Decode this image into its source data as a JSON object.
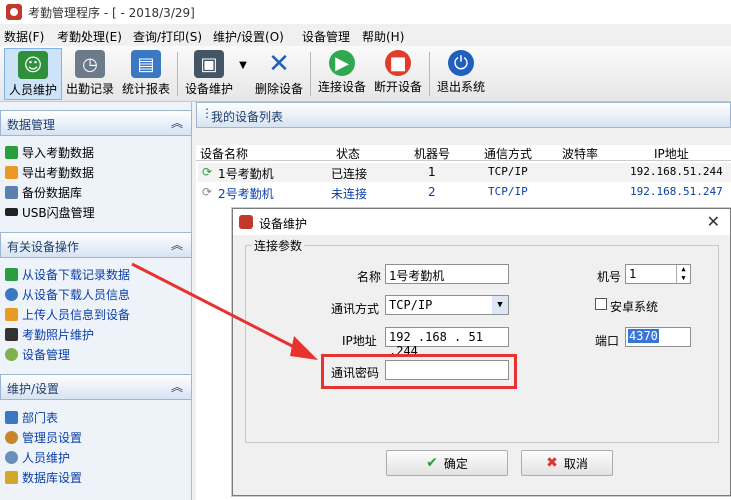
{
  "window": {
    "title": "考勤管理程序 - [ - 2018/3/29]"
  },
  "menu": [
    "数据(F)",
    "考勤处理(E)",
    "查询/打印(S)",
    "维护/设置(O)",
    "设备管理",
    "帮助(H)"
  ],
  "toolbar": [
    {
      "label": "人员维护",
      "icon": "people-icon"
    },
    {
      "label": "出勤记录",
      "icon": "clock-icon"
    },
    {
      "label": "统计报表",
      "icon": "report-icon"
    },
    {
      "label": "设备维护",
      "icon": "device-icon"
    },
    {
      "label": "删除设备",
      "icon": "delete-x-icon"
    },
    {
      "label": "连接设备",
      "icon": "play-icon"
    },
    {
      "label": "断开设备",
      "icon": "stop-icon"
    },
    {
      "label": "退出系统",
      "icon": "power-icon"
    }
  ],
  "sidebar": {
    "sections": [
      {
        "title": "数据管理",
        "items": [
          "导入考勤数据",
          "导出考勤数据",
          "备份数据库",
          "USB闪盘管理"
        ]
      },
      {
        "title": "有关设备操作",
        "items": [
          "从设备下载记录数据",
          "从设备下载人员信息",
          "上传人员信息到设备",
          "考勤照片维护",
          "设备管理"
        ]
      },
      {
        "title": "维护/设置",
        "items": [
          "部门表",
          "管理员设置",
          "人员维护",
          "数据库设置"
        ]
      }
    ],
    "collapse_glyph": "︽"
  },
  "device_list": {
    "title": "我的设备列表",
    "columns": [
      "设备名称",
      "状态",
      "机器号",
      "通信方式",
      "波特率",
      "IP地址"
    ],
    "rows": [
      {
        "name": "1号考勤机",
        "status": "已连接",
        "machine": "1",
        "comm": "TCP/IP",
        "baud": "",
        "ip": "192.168.51.244"
      },
      {
        "name": "2号考勤机",
        "status": "未连接",
        "machine": "2",
        "comm": "TCP/IP",
        "baud": "",
        "ip": "192.168.51.247"
      }
    ]
  },
  "dialog": {
    "title": "设备维护",
    "group": "连接参数",
    "name_label": "名称",
    "name_value": "1号考勤机",
    "comm_label": "通讯方式",
    "comm_value": "TCP/IP",
    "ip_label": "IP地址",
    "ip_value": "192 .168 . 51 .244",
    "password_label": "通讯密码",
    "password_value": "",
    "machine_label": "机号",
    "machine_value": "1",
    "android_label": "安卓系统",
    "port_label": "端口",
    "port_value": "4370",
    "ok_label": "确定",
    "cancel_label": "取消",
    "close_glyph": "✕"
  },
  "colors": {
    "accent_red": "#e8322f",
    "link_blue": "#0b3fa8"
  }
}
